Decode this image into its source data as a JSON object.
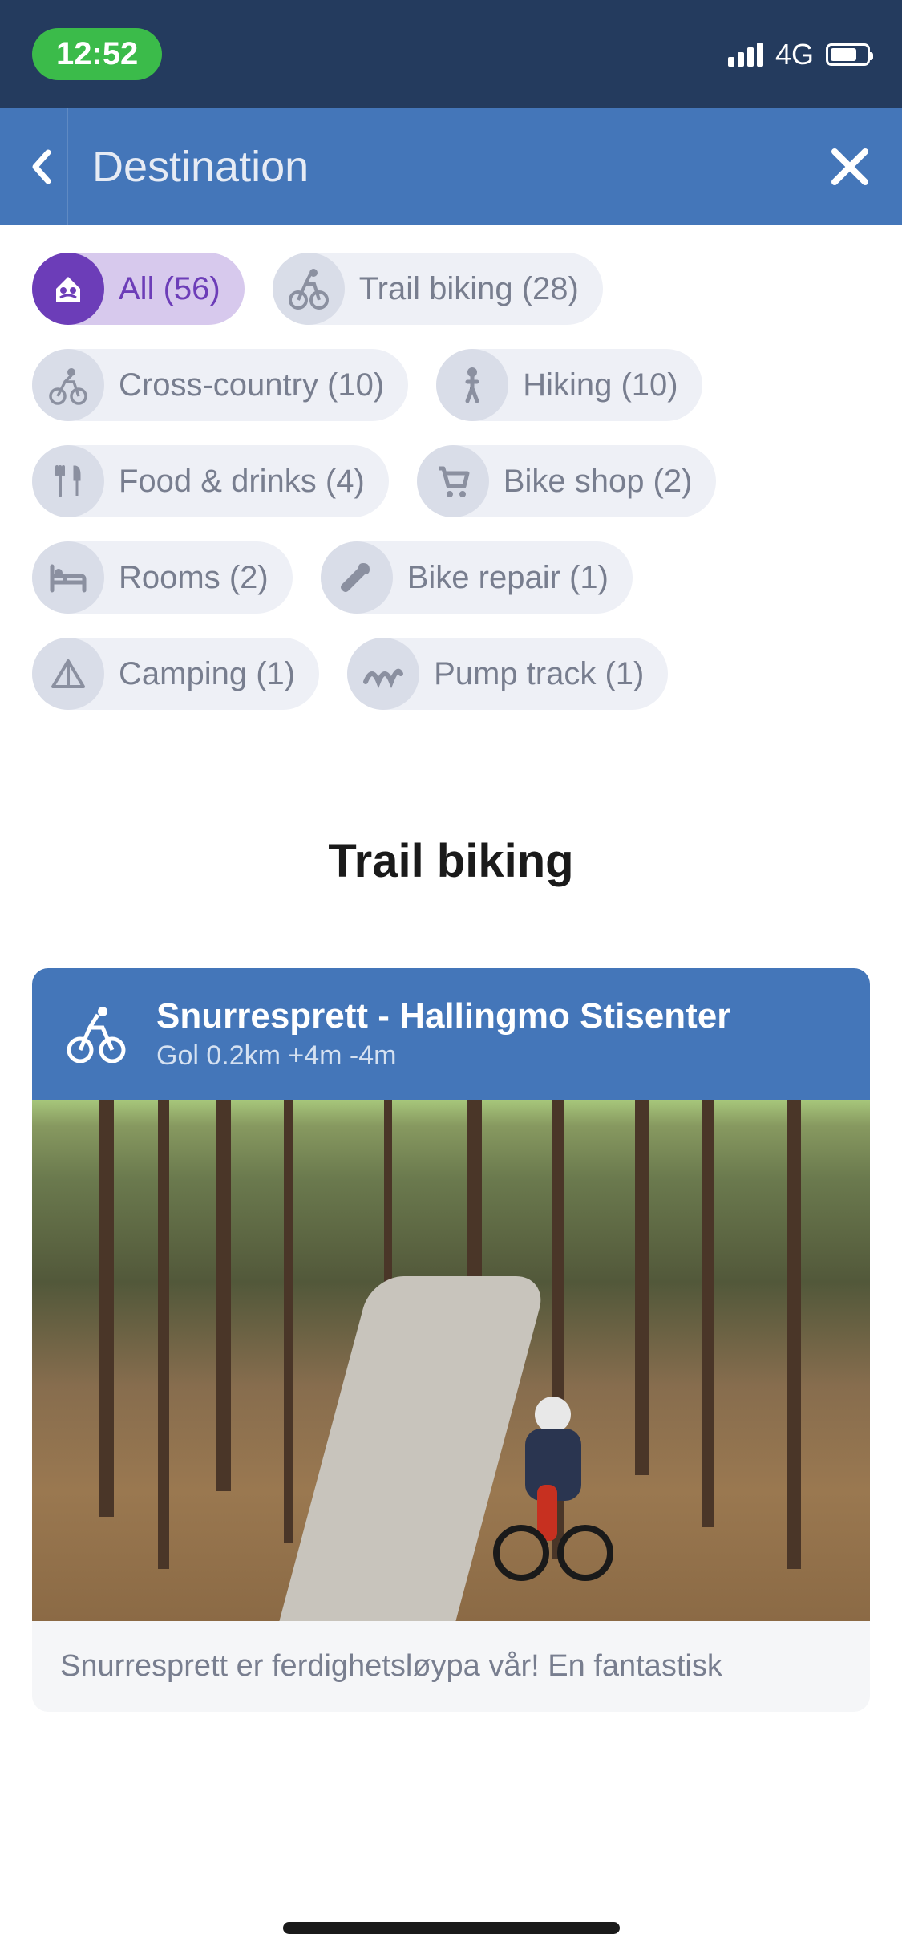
{
  "status": {
    "time": "12:52",
    "network": "4G"
  },
  "header": {
    "title": "Destination"
  },
  "filters": [
    {
      "label": "All (56)",
      "icon": "house-icon",
      "active": true
    },
    {
      "label": "Trail biking (28)",
      "icon": "mtb-icon",
      "active": false
    },
    {
      "label": "Cross-country (10)",
      "icon": "cycling-icon",
      "active": false
    },
    {
      "label": "Hiking (10)",
      "icon": "hiking-icon",
      "active": false
    },
    {
      "label": "Food & drinks (4)",
      "icon": "food-icon",
      "active": false
    },
    {
      "label": "Bike shop (2)",
      "icon": "cart-icon",
      "active": false
    },
    {
      "label": "Rooms (2)",
      "icon": "bed-icon",
      "active": false
    },
    {
      "label": "Bike repair (1)",
      "icon": "wrench-icon",
      "active": false
    },
    {
      "label": "Camping (1)",
      "icon": "tent-icon",
      "active": false
    },
    {
      "label": "Pump track (1)",
      "icon": "pump-icon",
      "active": false
    }
  ],
  "section": {
    "title": "Trail biking"
  },
  "card": {
    "title": "Snurresprett - Hallingmo Stisenter",
    "subtitle": "Gol 0.2km +4m -4m",
    "description": "Snurresprett er ferdighetsløypa vår! En fantastisk"
  }
}
